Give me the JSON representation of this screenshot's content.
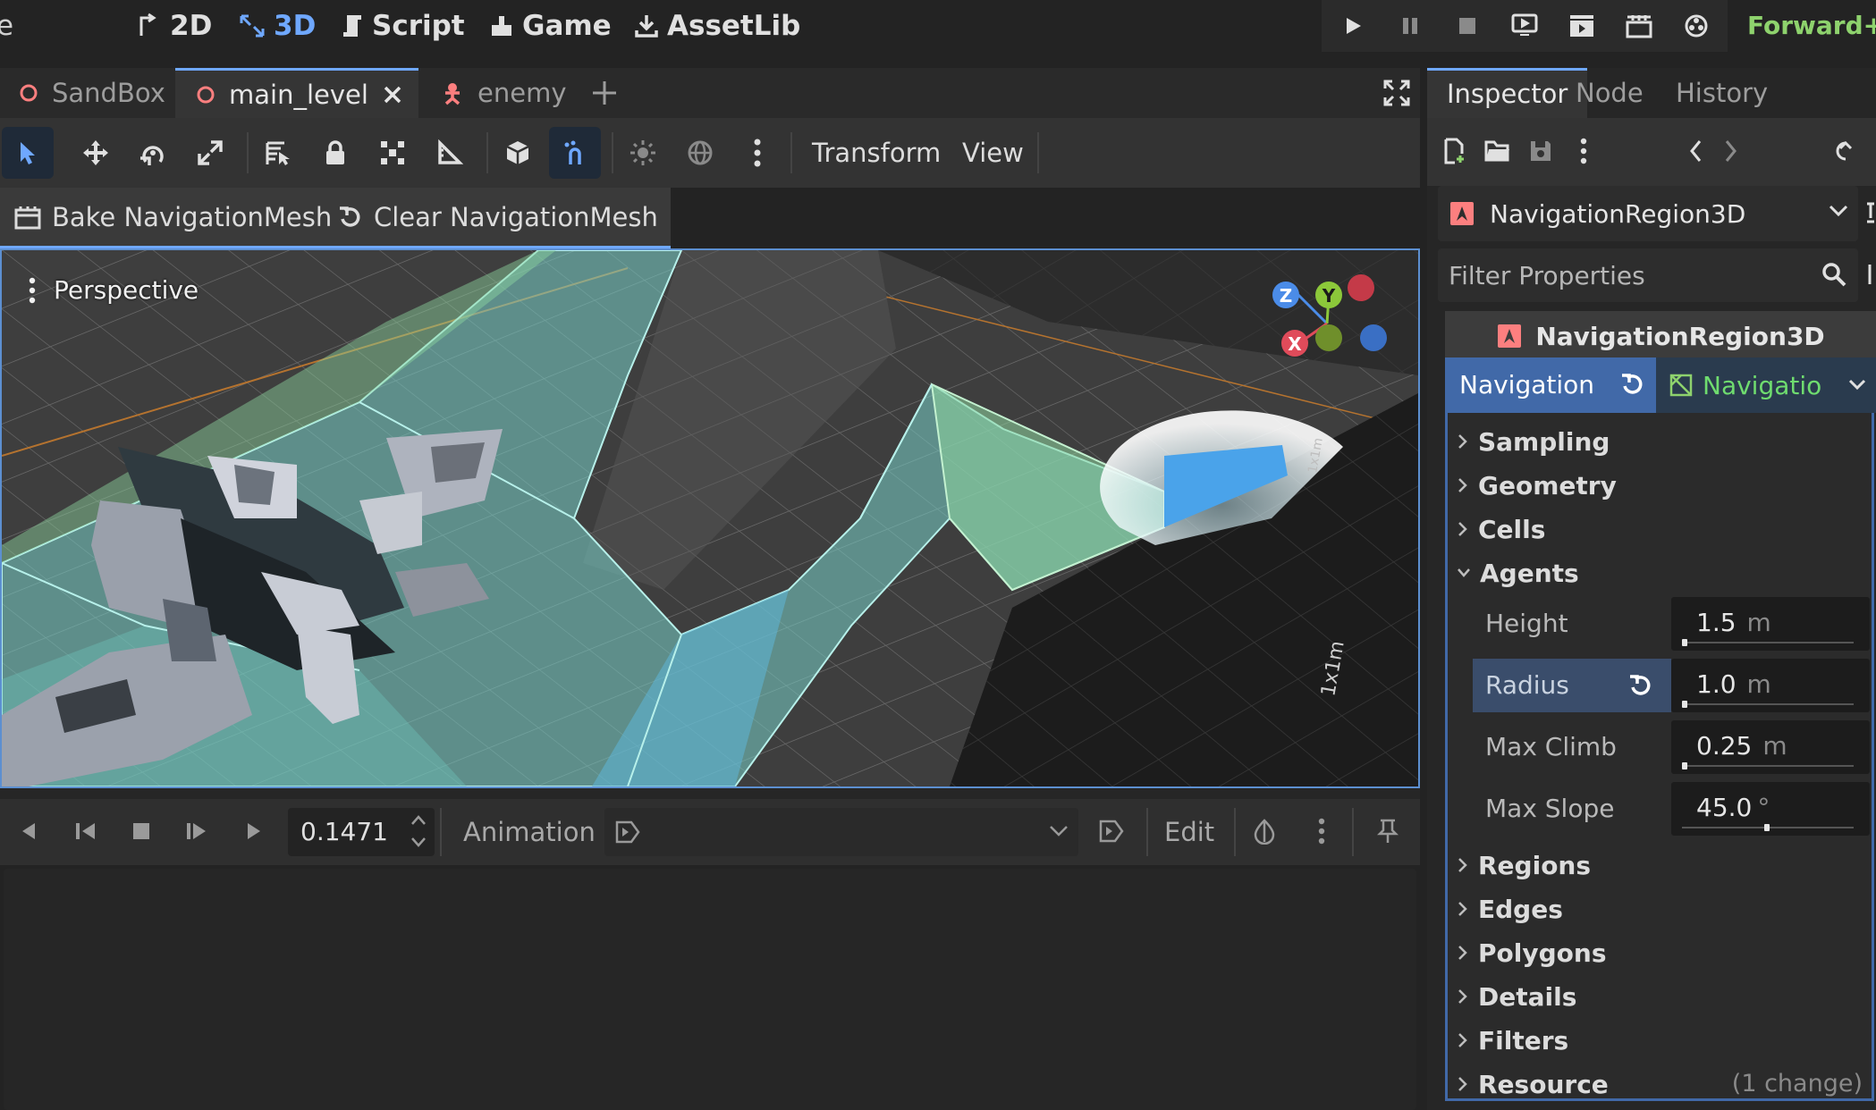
{
  "top_bar": {
    "cut_left_text": "e",
    "main_screens": [
      {
        "label": "2D",
        "icon": "2d-icon"
      },
      {
        "label": "3D",
        "icon": "3d-icon",
        "active": true
      },
      {
        "label": "Script",
        "icon": "script-icon"
      },
      {
        "label": "Game",
        "icon": "game-icon"
      },
      {
        "label": "AssetLib",
        "icon": "assetlib-icon"
      }
    ],
    "run_buttons": [
      "play-icon",
      "pause-icon",
      "stop-icon",
      "remote-debug-icon",
      "movie-icon",
      "clapper-icon",
      "pending-icon"
    ],
    "renderer": "Forward+",
    "colors": {
      "active_blue": "#6fa8ff",
      "renderer_green": "#8ed26d"
    }
  },
  "scene_tabs": [
    {
      "label": "SandBox",
      "icon": "scene-circle-icon",
      "active": false
    },
    {
      "label": "main_level",
      "icon": "scene-circle-icon",
      "active": true,
      "closable": true
    },
    {
      "label": "enemy",
      "icon": "enemy-node-icon",
      "active": false
    }
  ],
  "toolbar": {
    "tools": [
      "select-icon",
      "move-icon",
      "rotate-icon",
      "scale-icon",
      "list-select-icon",
      "lock-icon",
      "group-icon",
      "ruler-icon",
      "local-space-icon",
      "snap-icon",
      "sun-icon",
      "environment-icon",
      "more-icon"
    ],
    "menus": {
      "transform": "Transform",
      "view": "View"
    }
  },
  "nav_toolbar": {
    "bake": "Bake NavigationMesh",
    "clear": "Clear NavigationMesh"
  },
  "viewport": {
    "label": "Perspective",
    "gizmo": {
      "x": "X",
      "y": "Y",
      "z": "Z"
    },
    "grid_label": "1x1m"
  },
  "animation": {
    "time": "0.1471",
    "label": "Animation",
    "edit": "Edit"
  },
  "inspector": {
    "tabs": [
      {
        "label": "Inspector",
        "active": true
      },
      {
        "label": "Node",
        "active": false
      },
      {
        "label": "History",
        "active": false
      }
    ],
    "node_name": "NavigationRegion3D",
    "filter_placeholder": "Filter Properties",
    "object_header": "NavigationRegion3D",
    "navigation_prop": {
      "label": "Navigation",
      "resource": "Navigatio"
    },
    "sections": {
      "sampling": "Sampling",
      "geometry": "Geometry",
      "cells": "Cells",
      "agents": "Agents",
      "regions": "Regions",
      "edges": "Edges",
      "polygons": "Polygons",
      "details": "Details",
      "filters": "Filters",
      "resource": "Resource"
    },
    "agent_props": [
      {
        "label": "Height",
        "value": "1.5",
        "unit": "m",
        "slider": 0.0
      },
      {
        "label": "Radius",
        "value": "1.0",
        "unit": "m",
        "slider": 0.0,
        "highlighted": true
      },
      {
        "label": "Max Climb",
        "value": "0.25",
        "unit": "m",
        "slider": 0.0
      },
      {
        "label": "Max Slope",
        "value": "45.0",
        "unit": "°",
        "slider": 0.5
      }
    ],
    "resource_change": "(1 change)"
  }
}
